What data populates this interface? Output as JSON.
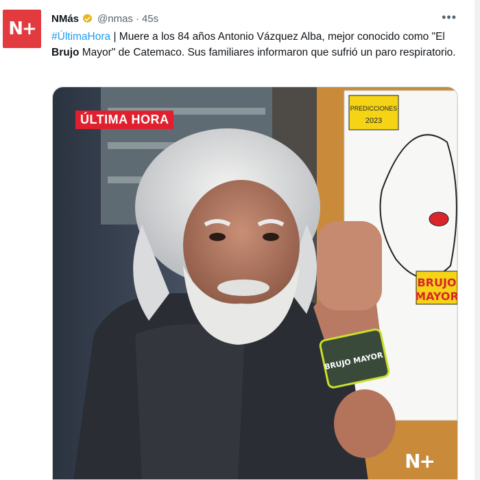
{
  "account": {
    "avatar_text": "N+",
    "name": "NMás",
    "handle": "@nmas",
    "separator": "·",
    "time": "45s",
    "verified_color": "#e2b719"
  },
  "tweet": {
    "hashtag": "#ÚltimaHora",
    "text_part1": " | Muere a los 84 años Antonio Vázquez Alba, mejor conocido como \"El ",
    "text_bold": "Brujo",
    "text_part2": " Mayor\" de Catemaco. Sus familiares informaron que sufrió un paro respiratorio."
  },
  "media": {
    "badge": "ÚLTIMA HORA",
    "logo": "N+",
    "poster_label": "PREDICCIONES 2023",
    "poster_brujo": "BRUJO",
    "poster_mayor": "MAYOR",
    "mic_label": "BRUJO MAYOR"
  },
  "icons": {
    "more": "more-horizontal-icon",
    "verified": "verified-badge-icon"
  }
}
